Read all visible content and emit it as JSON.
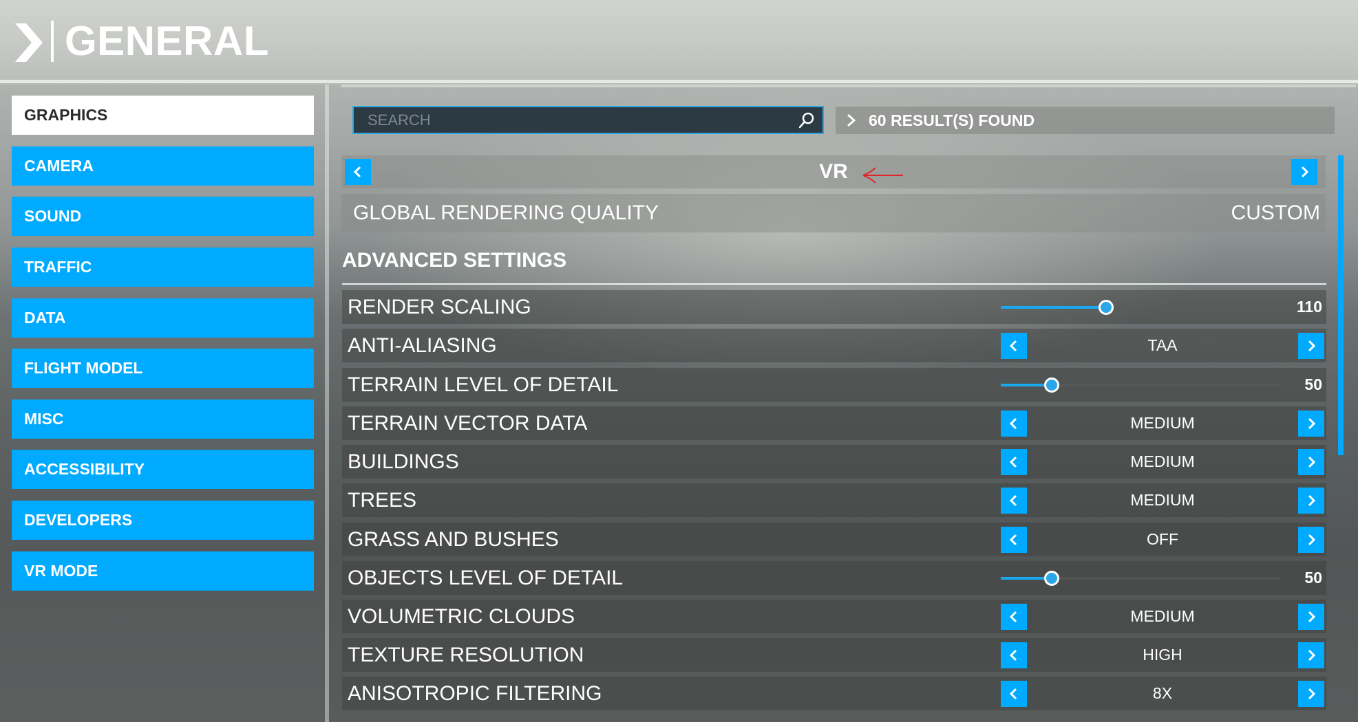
{
  "header": {
    "title": "GENERAL"
  },
  "sidebar": {
    "items": [
      {
        "label": "GRAPHICS",
        "active": true
      },
      {
        "label": "CAMERA"
      },
      {
        "label": "SOUND"
      },
      {
        "label": "TRAFFIC"
      },
      {
        "label": "DATA"
      },
      {
        "label": "FLIGHT MODEL"
      },
      {
        "label": "MISC"
      },
      {
        "label": "ACCESSIBILITY"
      },
      {
        "label": "DEVELOPERS"
      },
      {
        "label": "VR MODE"
      }
    ]
  },
  "search": {
    "placeholder": "SEARCH",
    "value": "",
    "results": "60 RESULT(S) FOUND"
  },
  "preset": {
    "label": "VR"
  },
  "global_quality": {
    "label": "GLOBAL RENDERING QUALITY",
    "value": "CUSTOM"
  },
  "advanced": {
    "heading": "ADVANCED SETTINGS",
    "settings": [
      {
        "label": "RENDER SCALING",
        "type": "slider",
        "value": "110",
        "fraction": 0.375
      },
      {
        "label": "ANTI-ALIASING",
        "type": "option",
        "value": "TAA"
      },
      {
        "label": "TERRAIN LEVEL OF DETAIL",
        "type": "slider",
        "value": "50",
        "fraction": 0.18
      },
      {
        "label": "TERRAIN VECTOR DATA",
        "type": "option",
        "value": "MEDIUM"
      },
      {
        "label": "BUILDINGS",
        "type": "option",
        "value": "MEDIUM"
      },
      {
        "label": "TREES",
        "type": "option",
        "value": "MEDIUM"
      },
      {
        "label": "GRASS AND BUSHES",
        "type": "option",
        "value": "OFF"
      },
      {
        "label": "OBJECTS LEVEL OF DETAIL",
        "type": "slider",
        "value": "50",
        "fraction": 0.18
      },
      {
        "label": "VOLUMETRIC CLOUDS",
        "type": "option",
        "value": "MEDIUM"
      },
      {
        "label": "TEXTURE RESOLUTION",
        "type": "option",
        "value": "HIGH"
      },
      {
        "label": "ANISOTROPIC FILTERING",
        "type": "option",
        "value": "8X"
      }
    ]
  },
  "colors": {
    "accent": "#00aaff",
    "annotation_arrow": "#e0242a"
  }
}
